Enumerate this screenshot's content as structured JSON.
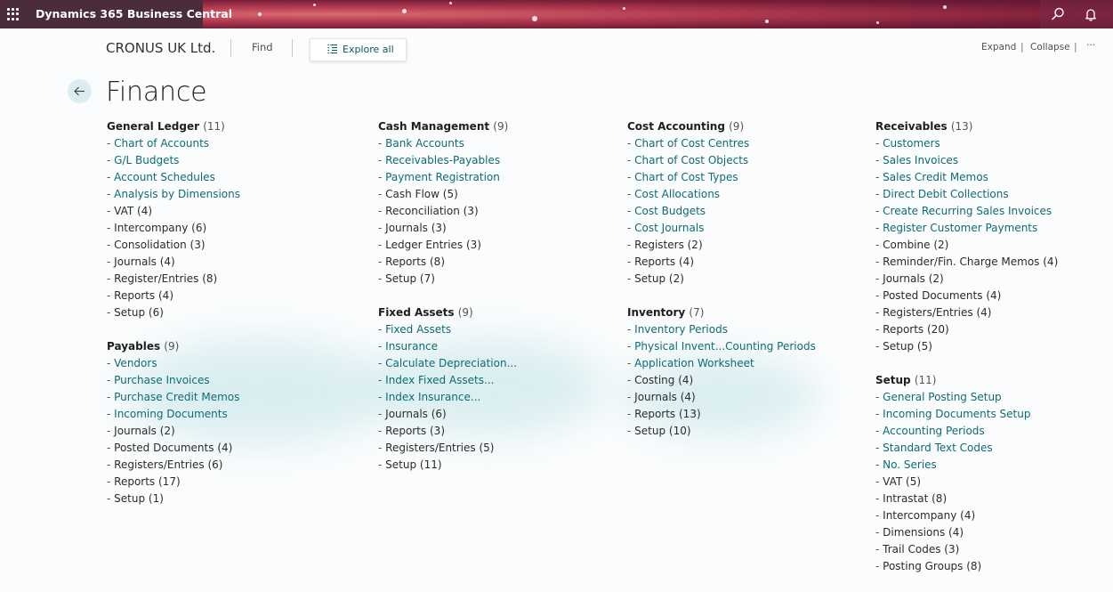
{
  "app_bar": {
    "title": "Dynamics 365 Business Central",
    "icons": [
      "waffle-icon",
      "search-icon",
      "bell-icon"
    ]
  },
  "command_bar": {
    "company": "CRONUS UK Ltd.",
    "find": "Find",
    "explore_all": "Explore all",
    "expand": "Expand",
    "collapse": "Collapse",
    "more": "···"
  },
  "page": {
    "title": "Finance"
  },
  "columns": [
    {
      "groups": [
        {
          "title": "General Ledger",
          "count": "(11)",
          "items": [
            {
              "label": "Chart of Accounts",
              "kind": "link"
            },
            {
              "label": "G/L Budgets",
              "kind": "link"
            },
            {
              "label": "Account Schedules",
              "kind": "link"
            },
            {
              "label": "Analysis by Dimensions",
              "kind": "link"
            },
            {
              "label": "VAT (4)",
              "kind": "sub"
            },
            {
              "label": "Intercompany (6)",
              "kind": "sub"
            },
            {
              "label": "Consolidation (3)",
              "kind": "sub"
            },
            {
              "label": "Journals (4)",
              "kind": "sub"
            },
            {
              "label": "Register/Entries (8)",
              "kind": "sub"
            },
            {
              "label": "Reports (4)",
              "kind": "sub"
            },
            {
              "label": "Setup (6)",
              "kind": "sub"
            }
          ]
        },
        {
          "title": "Payables",
          "count": "(9)",
          "items": [
            {
              "label": "Vendors",
              "kind": "link"
            },
            {
              "label": "Purchase Invoices",
              "kind": "link"
            },
            {
              "label": "Purchase Credit Memos",
              "kind": "link"
            },
            {
              "label": "Incoming Documents",
              "kind": "link"
            },
            {
              "label": "Journals (2)",
              "kind": "sub"
            },
            {
              "label": "Posted Documents (4)",
              "kind": "sub"
            },
            {
              "label": "Registers/Entries (6)",
              "kind": "sub"
            },
            {
              "label": "Reports (17)",
              "kind": "sub"
            },
            {
              "label": "Setup (1)",
              "kind": "sub"
            }
          ]
        }
      ]
    },
    {
      "groups": [
        {
          "title": "Cash Management",
          "count": "(9)",
          "items": [
            {
              "label": "Bank Accounts",
              "kind": "link"
            },
            {
              "label": "Receivables-Payables",
              "kind": "link"
            },
            {
              "label": "Payment Registration",
              "kind": "link"
            },
            {
              "label": "Cash Flow (5)",
              "kind": "sub"
            },
            {
              "label": "Reconciliation (3)",
              "kind": "sub"
            },
            {
              "label": "Journals (3)",
              "kind": "sub"
            },
            {
              "label": "Ledger Entries (3)",
              "kind": "sub"
            },
            {
              "label": "Reports (8)",
              "kind": "sub"
            },
            {
              "label": "Setup (7)",
              "kind": "sub"
            }
          ]
        },
        {
          "title": "Fixed Assets",
          "count": "(9)",
          "items": [
            {
              "label": "Fixed Assets",
              "kind": "link"
            },
            {
              "label": "Insurance",
              "kind": "link"
            },
            {
              "label": "Calculate Depreciation...",
              "kind": "link"
            },
            {
              "label": "Index Fixed Assets...",
              "kind": "link"
            },
            {
              "label": "Index Insurance...",
              "kind": "link"
            },
            {
              "label": "Journals (6)",
              "kind": "sub"
            },
            {
              "label": "Reports (3)",
              "kind": "sub"
            },
            {
              "label": "Registers/Entries (5)",
              "kind": "sub"
            },
            {
              "label": "Setup (11)",
              "kind": "sub"
            }
          ]
        }
      ]
    },
    {
      "groups": [
        {
          "title": "Cost Accounting",
          "count": "(9)",
          "items": [
            {
              "label": "Chart of Cost Centres",
              "kind": "link"
            },
            {
              "label": "Chart of Cost Objects",
              "kind": "link"
            },
            {
              "label": "Chart of Cost Types",
              "kind": "link"
            },
            {
              "label": "Cost Allocations",
              "kind": "link"
            },
            {
              "label": "Cost Budgets",
              "kind": "link"
            },
            {
              "label": "Cost Journals",
              "kind": "link"
            },
            {
              "label": "Registers (2)",
              "kind": "sub"
            },
            {
              "label": "Reports (4)",
              "kind": "sub"
            },
            {
              "label": "Setup (2)",
              "kind": "sub"
            }
          ]
        },
        {
          "title": "Inventory",
          "count": "(7)",
          "items": [
            {
              "label": "Inventory Periods",
              "kind": "link"
            },
            {
              "label": "Physical Invent...Counting Periods",
              "kind": "link"
            },
            {
              "label": "Application Worksheet",
              "kind": "link"
            },
            {
              "label": "Costing (4)",
              "kind": "sub"
            },
            {
              "label": "Journals (4)",
              "kind": "sub"
            },
            {
              "label": "Reports (13)",
              "kind": "sub"
            },
            {
              "label": "Setup (10)",
              "kind": "sub"
            }
          ]
        }
      ]
    },
    {
      "groups": [
        {
          "title": "Receivables",
          "count": "(13)",
          "items": [
            {
              "label": "Customers",
              "kind": "link"
            },
            {
              "label": "Sales Invoices",
              "kind": "link"
            },
            {
              "label": "Sales Credit Memos",
              "kind": "link"
            },
            {
              "label": "Direct Debit Collections",
              "kind": "link"
            },
            {
              "label": "Create Recurring Sales Invoices",
              "kind": "link"
            },
            {
              "label": "Register Customer Payments",
              "kind": "link"
            },
            {
              "label": "Combine (2)",
              "kind": "sub"
            },
            {
              "label": "Reminder/Fin. Charge Memos (4)",
              "kind": "sub"
            },
            {
              "label": "Journals (2)",
              "kind": "sub"
            },
            {
              "label": "Posted Documents (4)",
              "kind": "sub"
            },
            {
              "label": "Registers/Entries (4)",
              "kind": "sub"
            },
            {
              "label": "Reports (20)",
              "kind": "sub"
            },
            {
              "label": "Setup (5)",
              "kind": "sub"
            }
          ]
        },
        {
          "title": "Setup",
          "count": "(11)",
          "items": [
            {
              "label": "General Posting Setup",
              "kind": "link"
            },
            {
              "label": "Incoming Documents Setup",
              "kind": "link"
            },
            {
              "label": "Accounting Periods",
              "kind": "link"
            },
            {
              "label": "Standard Text Codes",
              "kind": "link"
            },
            {
              "label": "No. Series",
              "kind": "link"
            },
            {
              "label": "VAT (5)",
              "kind": "sub"
            },
            {
              "label": "Intrastat (8)",
              "kind": "sub"
            },
            {
              "label": "Intercompany (4)",
              "kind": "sub"
            },
            {
              "label": "Dimensions (4)",
              "kind": "sub"
            },
            {
              "label": "Trail Codes (3)",
              "kind": "sub"
            },
            {
              "label": "Posting Groups (8)",
              "kind": "sub"
            }
          ]
        }
      ]
    }
  ]
}
